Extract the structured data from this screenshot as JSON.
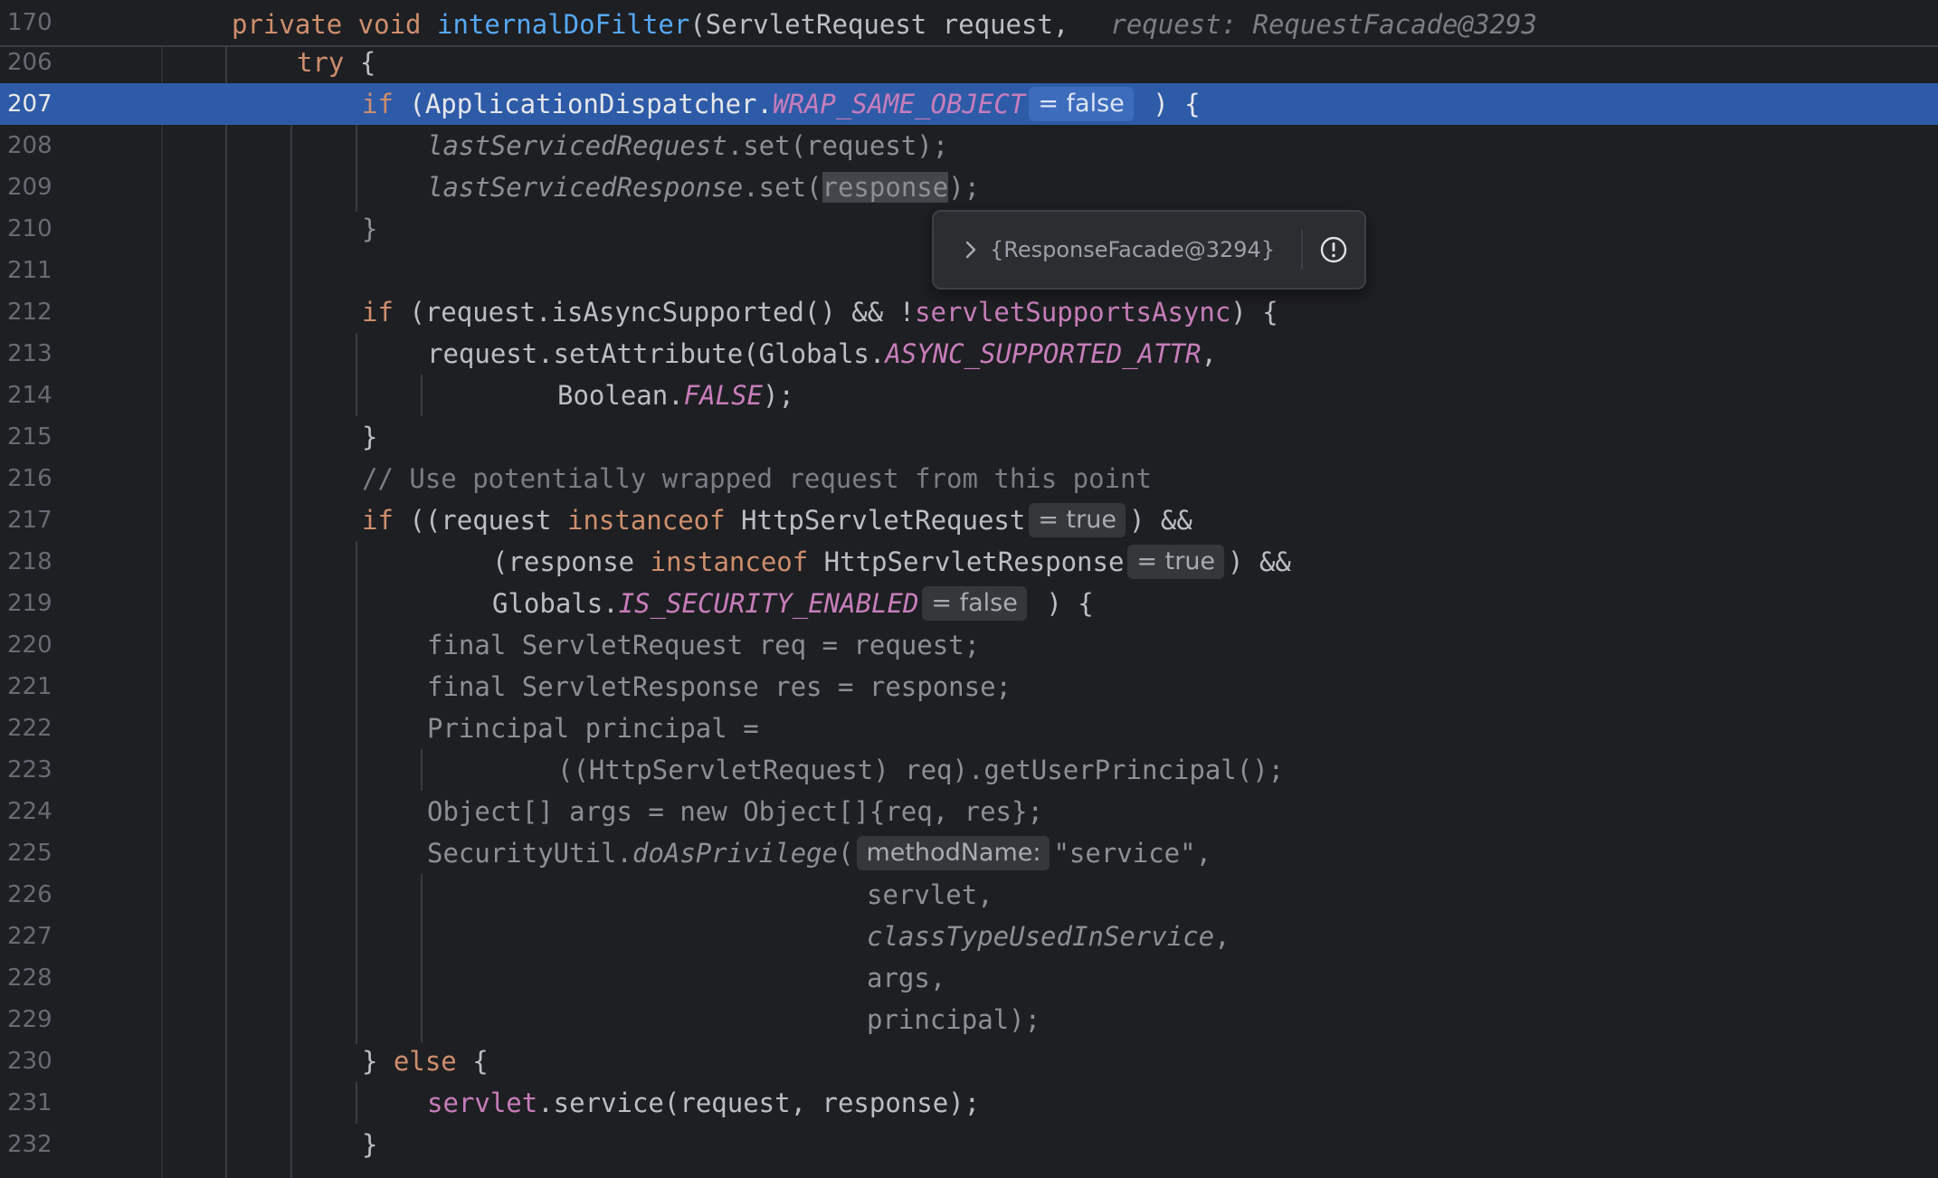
{
  "sticky_line": {
    "number": "170",
    "pre": "private void ",
    "name": "internalDoFilter",
    "args": "(ServletRequest request,",
    "hint": "request: RequestFacade@3293"
  },
  "lines": {
    "l206": {
      "n": "206",
      "t1": "try",
      "t2": " {"
    },
    "l207": {
      "n": "207",
      "t1": "if",
      "t2": " (ApplicationDispatcher.",
      "t3": "WRAP_SAME_OBJECT",
      "hint": "= false",
      "t4": " ) {"
    },
    "l208": {
      "n": "208",
      "t1": "lastServicedRequest",
      "t2": ".set(request);"
    },
    "l209": {
      "n": "209",
      "t1": "lastServicedResponse",
      "t2": ".set(",
      "t3": "response",
      "t4": ");"
    },
    "l210": {
      "n": "210",
      "t1": "}"
    },
    "l211": {
      "n": "211"
    },
    "l212": {
      "n": "212",
      "t1": "if",
      "t2": " (request.isAsyncSupported() && !",
      "t3": "servletSupportsAsync",
      "t4": ") {"
    },
    "l213": {
      "n": "213",
      "t1": "request.setAttribute(Globals.",
      "t2": "ASYNC_SUPPORTED_ATTR",
      "t3": ","
    },
    "l214": {
      "n": "214",
      "t1": "Boolean.",
      "t2": "FALSE",
      "t3": ");"
    },
    "l215": {
      "n": "215",
      "t1": "}"
    },
    "l216": {
      "n": "216",
      "t1": "// Use potentially wrapped request from this point"
    },
    "l217": {
      "n": "217",
      "t1": "if",
      "t2": " ((request ",
      "t3": "instanceof",
      "t4": " HttpServletRequest",
      "hint": "= true",
      "t5": ") &&"
    },
    "l218": {
      "n": "218",
      "t1": "(response ",
      "t2": "instanceof",
      "t3": " HttpServletResponse",
      "hint": "= true",
      "t4": ") &&"
    },
    "l219": {
      "n": "219",
      "t1": "Globals.",
      "t2": "IS_SECURITY_ENABLED",
      "hint": "= false",
      "t3": " ) {"
    },
    "l220": {
      "n": "220",
      "t1": "final ServletRequest req = request;"
    },
    "l221": {
      "n": "221",
      "t1": "final ServletResponse res = response;"
    },
    "l222": {
      "n": "222",
      "t1": "Principal principal ="
    },
    "l223": {
      "n": "223",
      "t1": "((HttpServletRequest) req).getUserPrincipal();"
    },
    "l224": {
      "n": "224",
      "t1": "Object[] args = new Object[]{req, res};"
    },
    "l225": {
      "n": "225",
      "t1": "SecurityUtil.",
      "t2": "doAsPrivilege",
      "t3": "(",
      "hint": "methodName:",
      "t4": "\"service\","
    },
    "l226": {
      "n": "226",
      "t1": "servlet,"
    },
    "l227": {
      "n": "227",
      "t1": "classTypeUsedInService",
      "t2": ","
    },
    "l228": {
      "n": "228",
      "t1": "args,"
    },
    "l229": {
      "n": "229",
      "t1": "principal);"
    },
    "l230": {
      "n": "230",
      "t1": "} ",
      "t2": "else",
      "t3": " {"
    },
    "l231": {
      "n": "231",
      "t1": "servlet",
      "t2": ".service(request, response);"
    },
    "l232": {
      "n": "232",
      "t1": "}"
    }
  },
  "popup": {
    "value": "{ResponseFacade@3294}",
    "expand_icon": "chevron-right-icon",
    "info_icon": "info-circle-icon"
  },
  "colors": {
    "background": "#1e1f22",
    "current_line": "#2e5ba8",
    "keyword": "#cf8e6d",
    "method": "#56a8f5",
    "static_field": "#c77dbb"
  }
}
